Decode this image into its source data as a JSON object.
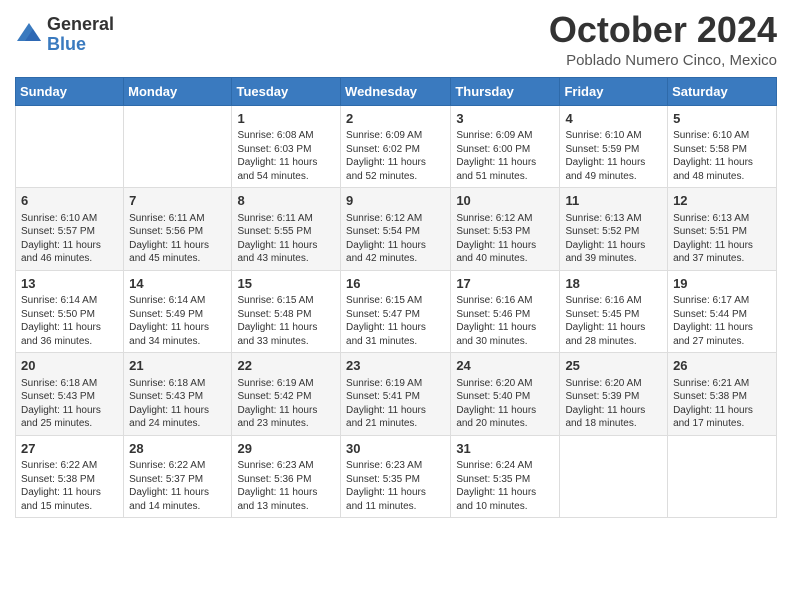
{
  "header": {
    "logo_general": "General",
    "logo_blue": "Blue",
    "month_title": "October 2024",
    "location": "Poblado Numero Cinco, Mexico"
  },
  "days_of_week": [
    "Sunday",
    "Monday",
    "Tuesday",
    "Wednesday",
    "Thursday",
    "Friday",
    "Saturday"
  ],
  "weeks": [
    [
      {
        "day": "",
        "info": ""
      },
      {
        "day": "",
        "info": ""
      },
      {
        "day": "1",
        "info": "Sunrise: 6:08 AM\nSunset: 6:03 PM\nDaylight: 11 hours and 54 minutes."
      },
      {
        "day": "2",
        "info": "Sunrise: 6:09 AM\nSunset: 6:02 PM\nDaylight: 11 hours and 52 minutes."
      },
      {
        "day": "3",
        "info": "Sunrise: 6:09 AM\nSunset: 6:00 PM\nDaylight: 11 hours and 51 minutes."
      },
      {
        "day": "4",
        "info": "Sunrise: 6:10 AM\nSunset: 5:59 PM\nDaylight: 11 hours and 49 minutes."
      },
      {
        "day": "5",
        "info": "Sunrise: 6:10 AM\nSunset: 5:58 PM\nDaylight: 11 hours and 48 minutes."
      }
    ],
    [
      {
        "day": "6",
        "info": "Sunrise: 6:10 AM\nSunset: 5:57 PM\nDaylight: 11 hours and 46 minutes."
      },
      {
        "day": "7",
        "info": "Sunrise: 6:11 AM\nSunset: 5:56 PM\nDaylight: 11 hours and 45 minutes."
      },
      {
        "day": "8",
        "info": "Sunrise: 6:11 AM\nSunset: 5:55 PM\nDaylight: 11 hours and 43 minutes."
      },
      {
        "day": "9",
        "info": "Sunrise: 6:12 AM\nSunset: 5:54 PM\nDaylight: 11 hours and 42 minutes."
      },
      {
        "day": "10",
        "info": "Sunrise: 6:12 AM\nSunset: 5:53 PM\nDaylight: 11 hours and 40 minutes."
      },
      {
        "day": "11",
        "info": "Sunrise: 6:13 AM\nSunset: 5:52 PM\nDaylight: 11 hours and 39 minutes."
      },
      {
        "day": "12",
        "info": "Sunrise: 6:13 AM\nSunset: 5:51 PM\nDaylight: 11 hours and 37 minutes."
      }
    ],
    [
      {
        "day": "13",
        "info": "Sunrise: 6:14 AM\nSunset: 5:50 PM\nDaylight: 11 hours and 36 minutes."
      },
      {
        "day": "14",
        "info": "Sunrise: 6:14 AM\nSunset: 5:49 PM\nDaylight: 11 hours and 34 minutes."
      },
      {
        "day": "15",
        "info": "Sunrise: 6:15 AM\nSunset: 5:48 PM\nDaylight: 11 hours and 33 minutes."
      },
      {
        "day": "16",
        "info": "Sunrise: 6:15 AM\nSunset: 5:47 PM\nDaylight: 11 hours and 31 minutes."
      },
      {
        "day": "17",
        "info": "Sunrise: 6:16 AM\nSunset: 5:46 PM\nDaylight: 11 hours and 30 minutes."
      },
      {
        "day": "18",
        "info": "Sunrise: 6:16 AM\nSunset: 5:45 PM\nDaylight: 11 hours and 28 minutes."
      },
      {
        "day": "19",
        "info": "Sunrise: 6:17 AM\nSunset: 5:44 PM\nDaylight: 11 hours and 27 minutes."
      }
    ],
    [
      {
        "day": "20",
        "info": "Sunrise: 6:18 AM\nSunset: 5:43 PM\nDaylight: 11 hours and 25 minutes."
      },
      {
        "day": "21",
        "info": "Sunrise: 6:18 AM\nSunset: 5:43 PM\nDaylight: 11 hours and 24 minutes."
      },
      {
        "day": "22",
        "info": "Sunrise: 6:19 AM\nSunset: 5:42 PM\nDaylight: 11 hours and 23 minutes."
      },
      {
        "day": "23",
        "info": "Sunrise: 6:19 AM\nSunset: 5:41 PM\nDaylight: 11 hours and 21 minutes."
      },
      {
        "day": "24",
        "info": "Sunrise: 6:20 AM\nSunset: 5:40 PM\nDaylight: 11 hours and 20 minutes."
      },
      {
        "day": "25",
        "info": "Sunrise: 6:20 AM\nSunset: 5:39 PM\nDaylight: 11 hours and 18 minutes."
      },
      {
        "day": "26",
        "info": "Sunrise: 6:21 AM\nSunset: 5:38 PM\nDaylight: 11 hours and 17 minutes."
      }
    ],
    [
      {
        "day": "27",
        "info": "Sunrise: 6:22 AM\nSunset: 5:38 PM\nDaylight: 11 hours and 15 minutes."
      },
      {
        "day": "28",
        "info": "Sunrise: 6:22 AM\nSunset: 5:37 PM\nDaylight: 11 hours and 14 minutes."
      },
      {
        "day": "29",
        "info": "Sunrise: 6:23 AM\nSunset: 5:36 PM\nDaylight: 11 hours and 13 minutes."
      },
      {
        "day": "30",
        "info": "Sunrise: 6:23 AM\nSunset: 5:35 PM\nDaylight: 11 hours and 11 minutes."
      },
      {
        "day": "31",
        "info": "Sunrise: 6:24 AM\nSunset: 5:35 PM\nDaylight: 11 hours and 10 minutes."
      },
      {
        "day": "",
        "info": ""
      },
      {
        "day": "",
        "info": ""
      }
    ]
  ]
}
